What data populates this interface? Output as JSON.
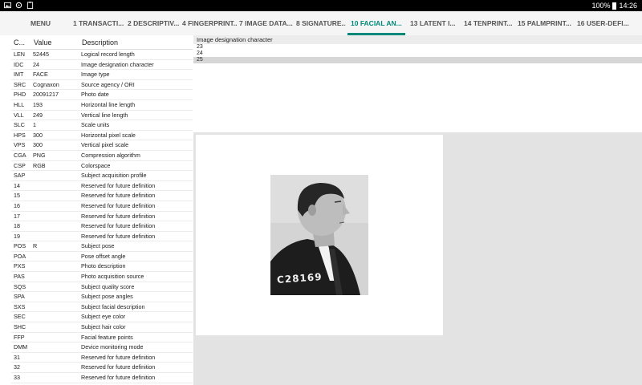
{
  "status_bar": {
    "battery": "100%",
    "time": "14:26"
  },
  "tabs": [
    {
      "label": "MENU",
      "active": false
    },
    {
      "label": "1 TRANSACTI...",
      "active": false
    },
    {
      "label": "2 DESCRIPTIV...",
      "active": false
    },
    {
      "label": "4 FINGERPRINT...",
      "active": false
    },
    {
      "label": "7 IMAGE DATA...",
      "active": false
    },
    {
      "label": "8 SIGNATURE...",
      "active": false
    },
    {
      "label": "10 FACIAL AN...",
      "active": true
    },
    {
      "label": "13 LATENT I...",
      "active": false
    },
    {
      "label": "14 TENPRINT...",
      "active": false
    },
    {
      "label": "15 PALMPRINT...",
      "active": false
    },
    {
      "label": "16 USER-DEFI...",
      "active": false
    }
  ],
  "table": {
    "headers": {
      "code": "C...",
      "value": "Value",
      "description": "Description"
    },
    "rows": [
      {
        "code": "LEN",
        "value": "52445",
        "description": "Logical record length"
      },
      {
        "code": "IDC",
        "value": "24",
        "description": "Image designation character"
      },
      {
        "code": "IMT",
        "value": "FACE",
        "description": "Image type"
      },
      {
        "code": "SRC",
        "value": "Cognaxon",
        "description": "Source agency / ORI"
      },
      {
        "code": "PHD",
        "value": "20091217",
        "description": "Photo date"
      },
      {
        "code": "HLL",
        "value": "193",
        "description": "Horizontal line length"
      },
      {
        "code": "VLL",
        "value": "249",
        "description": "Vertical line length"
      },
      {
        "code": "SLC",
        "value": "1",
        "description": "Scale units"
      },
      {
        "code": "HPS",
        "value": "300",
        "description": "Horizontal pixel scale"
      },
      {
        "code": "VPS",
        "value": "300",
        "description": "Vertical pixel scale"
      },
      {
        "code": "CGA",
        "value": "PNG",
        "description": "Compression algorithm"
      },
      {
        "code": "CSP",
        "value": "RGB",
        "description": "Colorspace"
      },
      {
        "code": "SAP",
        "value": "",
        "description": "Subject acquisition profile"
      },
      {
        "code": "14",
        "value": "",
        "description": "Reserved for future definition"
      },
      {
        "code": "15",
        "value": "",
        "description": "Reserved for future definition"
      },
      {
        "code": "16",
        "value": "",
        "description": "Reserved for future definition"
      },
      {
        "code": "17",
        "value": "",
        "description": "Reserved for future definition"
      },
      {
        "code": "18",
        "value": "",
        "description": "Reserved for future definition"
      },
      {
        "code": "19",
        "value": "",
        "description": "Reserved for future definition"
      },
      {
        "code": "POS",
        "value": "R",
        "description": "Subject pose"
      },
      {
        "code": "POA",
        "value": "",
        "description": "Pose offset angle"
      },
      {
        "code": "PXS",
        "value": "",
        "description": "Photo description"
      },
      {
        "code": "PAS",
        "value": "",
        "description": "Photo acquisition source"
      },
      {
        "code": "SQS",
        "value": "",
        "description": "Subject quality score"
      },
      {
        "code": "SPA",
        "value": "",
        "description": "Subject pose angles"
      },
      {
        "code": "SXS",
        "value": "",
        "description": "Subject facial description"
      },
      {
        "code": "SEC",
        "value": "",
        "description": "Subject eye color"
      },
      {
        "code": "SHC",
        "value": "",
        "description": "Subject hair color"
      },
      {
        "code": "FFP",
        "value": "",
        "description": "Facial feature points"
      },
      {
        "code": "DMM",
        "value": "",
        "description": "Device monitoring mode"
      },
      {
        "code": "31",
        "value": "",
        "description": "Reserved for future definition"
      },
      {
        "code": "32",
        "value": "",
        "description": "Reserved for future definition"
      },
      {
        "code": "33",
        "value": "",
        "description": "Reserved for future definition"
      }
    ]
  },
  "value_list": {
    "header": "Image designation character",
    "items": [
      "23",
      "24",
      "25"
    ],
    "selected_index": 2
  },
  "photo": {
    "placard_text": "C28169"
  },
  "colors": {
    "accent": "#00897b",
    "status_bar": "#000000",
    "panel_bg": "#e3e3e3"
  }
}
